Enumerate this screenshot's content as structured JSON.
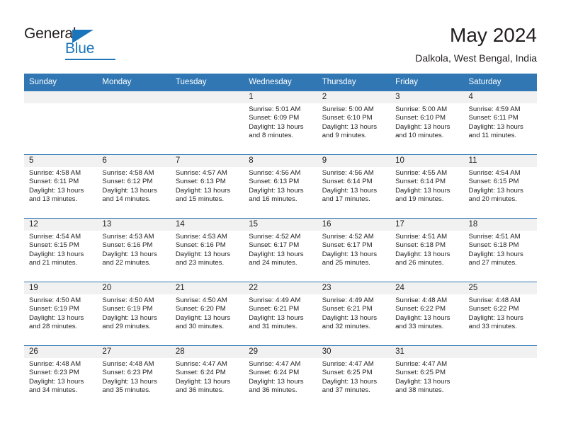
{
  "brand": {
    "name_part1": "General",
    "name_part2": "Blue"
  },
  "header": {
    "title": "May 2024",
    "subtitle": "Dalkola, West Bengal, India"
  },
  "colors": {
    "header_blue": "#3077b4",
    "brand_blue": "#1b75bb",
    "daynum_band": "#f1f1f1",
    "text": "#231f20"
  },
  "weekday_headers": [
    "Sunday",
    "Monday",
    "Tuesday",
    "Wednesday",
    "Thursday",
    "Friday",
    "Saturday"
  ],
  "weeks": [
    [
      {
        "day": "",
        "sunrise": "",
        "sunset": "",
        "daylight": "",
        "empty": true
      },
      {
        "day": "",
        "sunrise": "",
        "sunset": "",
        "daylight": "",
        "empty": true
      },
      {
        "day": "",
        "sunrise": "",
        "sunset": "",
        "daylight": "",
        "empty": true
      },
      {
        "day": "1",
        "sunrise": "Sunrise: 5:01 AM",
        "sunset": "Sunset: 6:09 PM",
        "daylight": "Daylight: 13 hours and 8 minutes.",
        "empty": false
      },
      {
        "day": "2",
        "sunrise": "Sunrise: 5:00 AM",
        "sunset": "Sunset: 6:10 PM",
        "daylight": "Daylight: 13 hours and 9 minutes.",
        "empty": false
      },
      {
        "day": "3",
        "sunrise": "Sunrise: 5:00 AM",
        "sunset": "Sunset: 6:10 PM",
        "daylight": "Daylight: 13 hours and 10 minutes.",
        "empty": false
      },
      {
        "day": "4",
        "sunrise": "Sunrise: 4:59 AM",
        "sunset": "Sunset: 6:11 PM",
        "daylight": "Daylight: 13 hours and 11 minutes.",
        "empty": false
      }
    ],
    [
      {
        "day": "5",
        "sunrise": "Sunrise: 4:58 AM",
        "sunset": "Sunset: 6:11 PM",
        "daylight": "Daylight: 13 hours and 13 minutes.",
        "empty": false
      },
      {
        "day": "6",
        "sunrise": "Sunrise: 4:58 AM",
        "sunset": "Sunset: 6:12 PM",
        "daylight": "Daylight: 13 hours and 14 minutes.",
        "empty": false
      },
      {
        "day": "7",
        "sunrise": "Sunrise: 4:57 AM",
        "sunset": "Sunset: 6:13 PM",
        "daylight": "Daylight: 13 hours and 15 minutes.",
        "empty": false
      },
      {
        "day": "8",
        "sunrise": "Sunrise: 4:56 AM",
        "sunset": "Sunset: 6:13 PM",
        "daylight": "Daylight: 13 hours and 16 minutes.",
        "empty": false
      },
      {
        "day": "9",
        "sunrise": "Sunrise: 4:56 AM",
        "sunset": "Sunset: 6:14 PM",
        "daylight": "Daylight: 13 hours and 17 minutes.",
        "empty": false
      },
      {
        "day": "10",
        "sunrise": "Sunrise: 4:55 AM",
        "sunset": "Sunset: 6:14 PM",
        "daylight": "Daylight: 13 hours and 19 minutes.",
        "empty": false
      },
      {
        "day": "11",
        "sunrise": "Sunrise: 4:54 AM",
        "sunset": "Sunset: 6:15 PM",
        "daylight": "Daylight: 13 hours and 20 minutes.",
        "empty": false
      }
    ],
    [
      {
        "day": "12",
        "sunrise": "Sunrise: 4:54 AM",
        "sunset": "Sunset: 6:15 PM",
        "daylight": "Daylight: 13 hours and 21 minutes.",
        "empty": false
      },
      {
        "day": "13",
        "sunrise": "Sunrise: 4:53 AM",
        "sunset": "Sunset: 6:16 PM",
        "daylight": "Daylight: 13 hours and 22 minutes.",
        "empty": false
      },
      {
        "day": "14",
        "sunrise": "Sunrise: 4:53 AM",
        "sunset": "Sunset: 6:16 PM",
        "daylight": "Daylight: 13 hours and 23 minutes.",
        "empty": false
      },
      {
        "day": "15",
        "sunrise": "Sunrise: 4:52 AM",
        "sunset": "Sunset: 6:17 PM",
        "daylight": "Daylight: 13 hours and 24 minutes.",
        "empty": false
      },
      {
        "day": "16",
        "sunrise": "Sunrise: 4:52 AM",
        "sunset": "Sunset: 6:17 PM",
        "daylight": "Daylight: 13 hours and 25 minutes.",
        "empty": false
      },
      {
        "day": "17",
        "sunrise": "Sunrise: 4:51 AM",
        "sunset": "Sunset: 6:18 PM",
        "daylight": "Daylight: 13 hours and 26 minutes.",
        "empty": false
      },
      {
        "day": "18",
        "sunrise": "Sunrise: 4:51 AM",
        "sunset": "Sunset: 6:18 PM",
        "daylight": "Daylight: 13 hours and 27 minutes.",
        "empty": false
      }
    ],
    [
      {
        "day": "19",
        "sunrise": "Sunrise: 4:50 AM",
        "sunset": "Sunset: 6:19 PM",
        "daylight": "Daylight: 13 hours and 28 minutes.",
        "empty": false
      },
      {
        "day": "20",
        "sunrise": "Sunrise: 4:50 AM",
        "sunset": "Sunset: 6:19 PM",
        "daylight": "Daylight: 13 hours and 29 minutes.",
        "empty": false
      },
      {
        "day": "21",
        "sunrise": "Sunrise: 4:50 AM",
        "sunset": "Sunset: 6:20 PM",
        "daylight": "Daylight: 13 hours and 30 minutes.",
        "empty": false
      },
      {
        "day": "22",
        "sunrise": "Sunrise: 4:49 AM",
        "sunset": "Sunset: 6:21 PM",
        "daylight": "Daylight: 13 hours and 31 minutes.",
        "empty": false
      },
      {
        "day": "23",
        "sunrise": "Sunrise: 4:49 AM",
        "sunset": "Sunset: 6:21 PM",
        "daylight": "Daylight: 13 hours and 32 minutes.",
        "empty": false
      },
      {
        "day": "24",
        "sunrise": "Sunrise: 4:48 AM",
        "sunset": "Sunset: 6:22 PM",
        "daylight": "Daylight: 13 hours and 33 minutes.",
        "empty": false
      },
      {
        "day": "25",
        "sunrise": "Sunrise: 4:48 AM",
        "sunset": "Sunset: 6:22 PM",
        "daylight": "Daylight: 13 hours and 33 minutes.",
        "empty": false
      }
    ],
    [
      {
        "day": "26",
        "sunrise": "Sunrise: 4:48 AM",
        "sunset": "Sunset: 6:23 PM",
        "daylight": "Daylight: 13 hours and 34 minutes.",
        "empty": false
      },
      {
        "day": "27",
        "sunrise": "Sunrise: 4:48 AM",
        "sunset": "Sunset: 6:23 PM",
        "daylight": "Daylight: 13 hours and 35 minutes.",
        "empty": false
      },
      {
        "day": "28",
        "sunrise": "Sunrise: 4:47 AM",
        "sunset": "Sunset: 6:24 PM",
        "daylight": "Daylight: 13 hours and 36 minutes.",
        "empty": false
      },
      {
        "day": "29",
        "sunrise": "Sunrise: 4:47 AM",
        "sunset": "Sunset: 6:24 PM",
        "daylight": "Daylight: 13 hours and 36 minutes.",
        "empty": false
      },
      {
        "day": "30",
        "sunrise": "Sunrise: 4:47 AM",
        "sunset": "Sunset: 6:25 PM",
        "daylight": "Daylight: 13 hours and 37 minutes.",
        "empty": false
      },
      {
        "day": "31",
        "sunrise": "Sunrise: 4:47 AM",
        "sunset": "Sunset: 6:25 PM",
        "daylight": "Daylight: 13 hours and 38 minutes.",
        "empty": false
      },
      {
        "day": "",
        "sunrise": "",
        "sunset": "",
        "daylight": "",
        "empty": true
      }
    ]
  ]
}
